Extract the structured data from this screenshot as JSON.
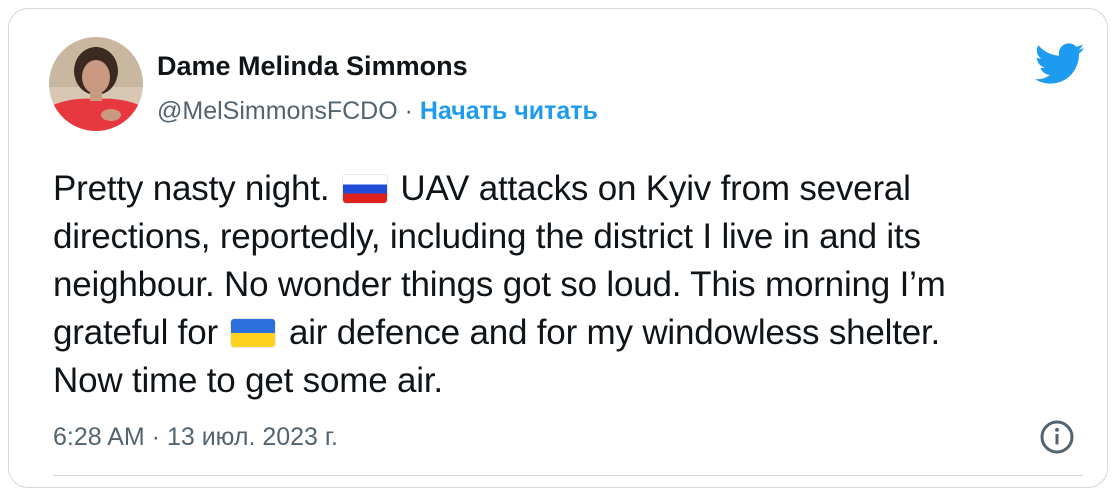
{
  "author": {
    "name": "Dame Melinda Simmons",
    "handle": "@MelSimmonsFCDO",
    "separator": "·",
    "follow_label": "Начать читать"
  },
  "tweet": {
    "lines": [
      {
        "before": "Pretty nasty night. ",
        "after": " UAV attacks on Kyiv from several"
      },
      {
        "text": "directions, reportedly, including the district I live in and its"
      },
      {
        "text": "neighbour. No wonder things got so loud. This morning I’m"
      },
      {
        "before": "grateful for ",
        "after": " air defence and for my windowless shelter."
      },
      {
        "text": "Now time to get some air."
      }
    ],
    "flags": [
      "russia-flag",
      "ukraine-flag"
    ]
  },
  "meta": {
    "timestamp": "6:28 AM · 13 июл. 2023 г."
  },
  "icons": {
    "brand": "twitter-bird-icon",
    "info": "info-icon"
  },
  "colors": {
    "link_blue": "#1d9bf0",
    "text_primary": "#0f1419",
    "text_secondary": "#536471",
    "border": "#cfd9de"
  }
}
